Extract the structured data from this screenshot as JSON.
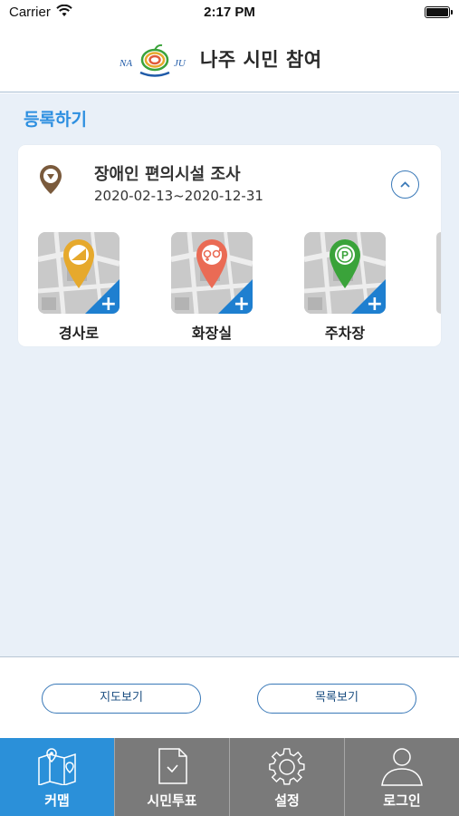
{
  "status_bar": {
    "carrier": "Carrier",
    "time": "2:17 PM"
  },
  "header": {
    "logo_left": "NA",
    "logo_right": "JU",
    "title": "나주 시민 참여"
  },
  "main": {
    "section_title": "등록하기",
    "survey": {
      "title": "장애인 편의시설 조사",
      "date_range": "2020-02-13~2020-12-31",
      "categories": [
        {
          "label": "경사로",
          "icon": "ramp-pin-icon",
          "color": "#e6a92c"
        },
        {
          "label": "화장실",
          "icon": "restroom-pin-icon",
          "color": "#ea6b55"
        },
        {
          "label": "주차장",
          "icon": "parking-pin-icon",
          "color": "#3aa33a"
        }
      ],
      "parking_symbol": "P"
    }
  },
  "footer": {
    "map_view": "지도보기",
    "list_view": "목록보기"
  },
  "tabbar": {
    "items": [
      {
        "label": "커맵",
        "icon": "map-icon",
        "active": true
      },
      {
        "label": "시민투표",
        "icon": "vote-document-icon",
        "active": false
      },
      {
        "label": "설정",
        "icon": "gear-icon",
        "active": false
      },
      {
        "label": "로그인",
        "icon": "person-icon",
        "active": false
      }
    ]
  },
  "colors": {
    "accent": "#2d8fe0",
    "tab_active": "#2b90d9",
    "tab_bg": "#7a7a7a",
    "content_bg": "#e9f0f8"
  }
}
